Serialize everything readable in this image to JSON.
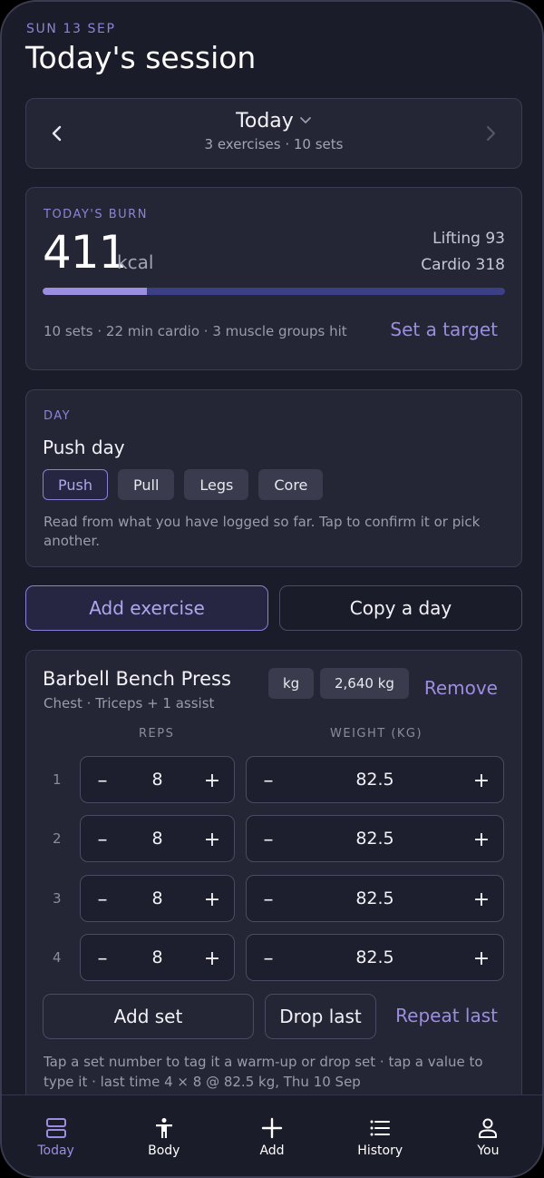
{
  "header": {
    "date": "SUN 13 SEP",
    "title": "Today's session"
  },
  "day_nav": {
    "title": "Today",
    "subtitle": "3 exercises · 10 sets"
  },
  "burn": {
    "label": "TODAY'S BURN",
    "value": "411",
    "unit": "kcal",
    "lifting": "Lifting 93",
    "cardio": "Cardio 318",
    "progress_fraction": 0.225,
    "summary": "10 sets · 22 min cardio · 3 muscle groups hit",
    "action": "Set a target"
  },
  "day": {
    "label": "DAY",
    "name": "Push day",
    "chips": [
      "Push",
      "Pull",
      "Legs",
      "Core"
    ],
    "selected_chip": "Push",
    "note": "Read from what you have logged so far. Tap to confirm it or pick another."
  },
  "actions": {
    "add_exercise": "Add exercise",
    "copy_day": "Copy a day"
  },
  "exercise": {
    "name": "Barbell Bench Press",
    "muscles": "Chest · Triceps + 1 assist",
    "unit_tag": "kg",
    "volume_tag": "2,640 kg",
    "remove": "Remove",
    "col_reps": "REPS",
    "col_weight": "WEIGHT (KG)",
    "sets": [
      {
        "num": "1",
        "reps": "8",
        "weight": "82.5"
      },
      {
        "num": "2",
        "reps": "8",
        "weight": "82.5"
      },
      {
        "num": "3",
        "reps": "8",
        "weight": "82.5"
      },
      {
        "num": "4",
        "reps": "8",
        "weight": "82.5"
      }
    ],
    "minus": "–",
    "plus": "+",
    "add_set": "Add set",
    "drop_last": "Drop last",
    "repeat_last": "Repeat last",
    "note": "Tap a set number to tag it a warm-up or drop set · tap a value to type it · last time 4 × 8 @ 82.5 kg, Thu 10 Sep"
  },
  "tabs": [
    {
      "label": "Today",
      "icon": "today-icon",
      "active": true
    },
    {
      "label": "Body",
      "icon": "body-icon",
      "active": false
    },
    {
      "label": "Add",
      "icon": "plus-icon",
      "active": false
    },
    {
      "label": "History",
      "icon": "list-icon",
      "active": false
    },
    {
      "label": "You",
      "icon": "person-icon",
      "active": false
    }
  ],
  "colors": {
    "accent": "#9b8ee0",
    "background": "#1b1c2a",
    "card": "#242535",
    "progress_track": "#3b3f86"
  }
}
